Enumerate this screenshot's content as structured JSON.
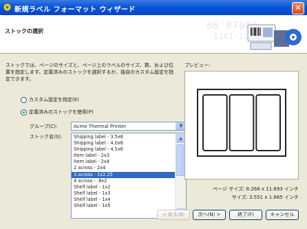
{
  "window": {
    "title": "新規ラベル フォーマット ウィザード"
  },
  "header": {
    "title": "ストックの選択",
    "watermark_line1": "86'07001",
    "watermark_line2": "11A7-11"
  },
  "description": "ストックでは、ページのサイズと、ページ上のラベルのサイズ、数、および位置を指定します。定義済みのストックを選択するか、独自のカスタム設定を指定できます。",
  "options": {
    "custom_label": "カスタム設定を指定(E)",
    "custom_selected": false,
    "predefined_label": "定義済みのストックを使用(P)",
    "predefined_selected": true
  },
  "group": {
    "label": "グループ(C):",
    "value": "Acme Thermal Printer"
  },
  "stock": {
    "label": "ストック名(S):",
    "items": [
      "Shipping label - 3.5x6",
      "Shipping label - 4.0x6",
      "Shipping label - 4.5x6",
      "Item label - 2x3",
      "Item label - 2x4",
      "2 across - 2x4",
      "3 across - 1x2.25",
      "4 across - .8x2",
      "Shelf label - 1x2",
      "Shelf label - 1x3",
      "Shelf label - 1x4",
      "Shelf label - 1x5"
    ],
    "selected_index": 6
  },
  "preview": {
    "label": "プレビュー:",
    "page_size_label": "ページ サイズ:",
    "page_size_value": "8.268 x 11.693 インチ",
    "size_label": "サイズ:",
    "size_value": "3.551 x 1.665 インチ",
    "label_count": 3
  },
  "buttons": {
    "back": "< 戻る(B)",
    "next": "次へ(N) >",
    "finish": "終了(F)",
    "cancel": "キャンセル"
  },
  "colors": {
    "titlebar": "#0a55d8",
    "selection": "#316ac5",
    "dialog_bg": "#ece9d8"
  }
}
